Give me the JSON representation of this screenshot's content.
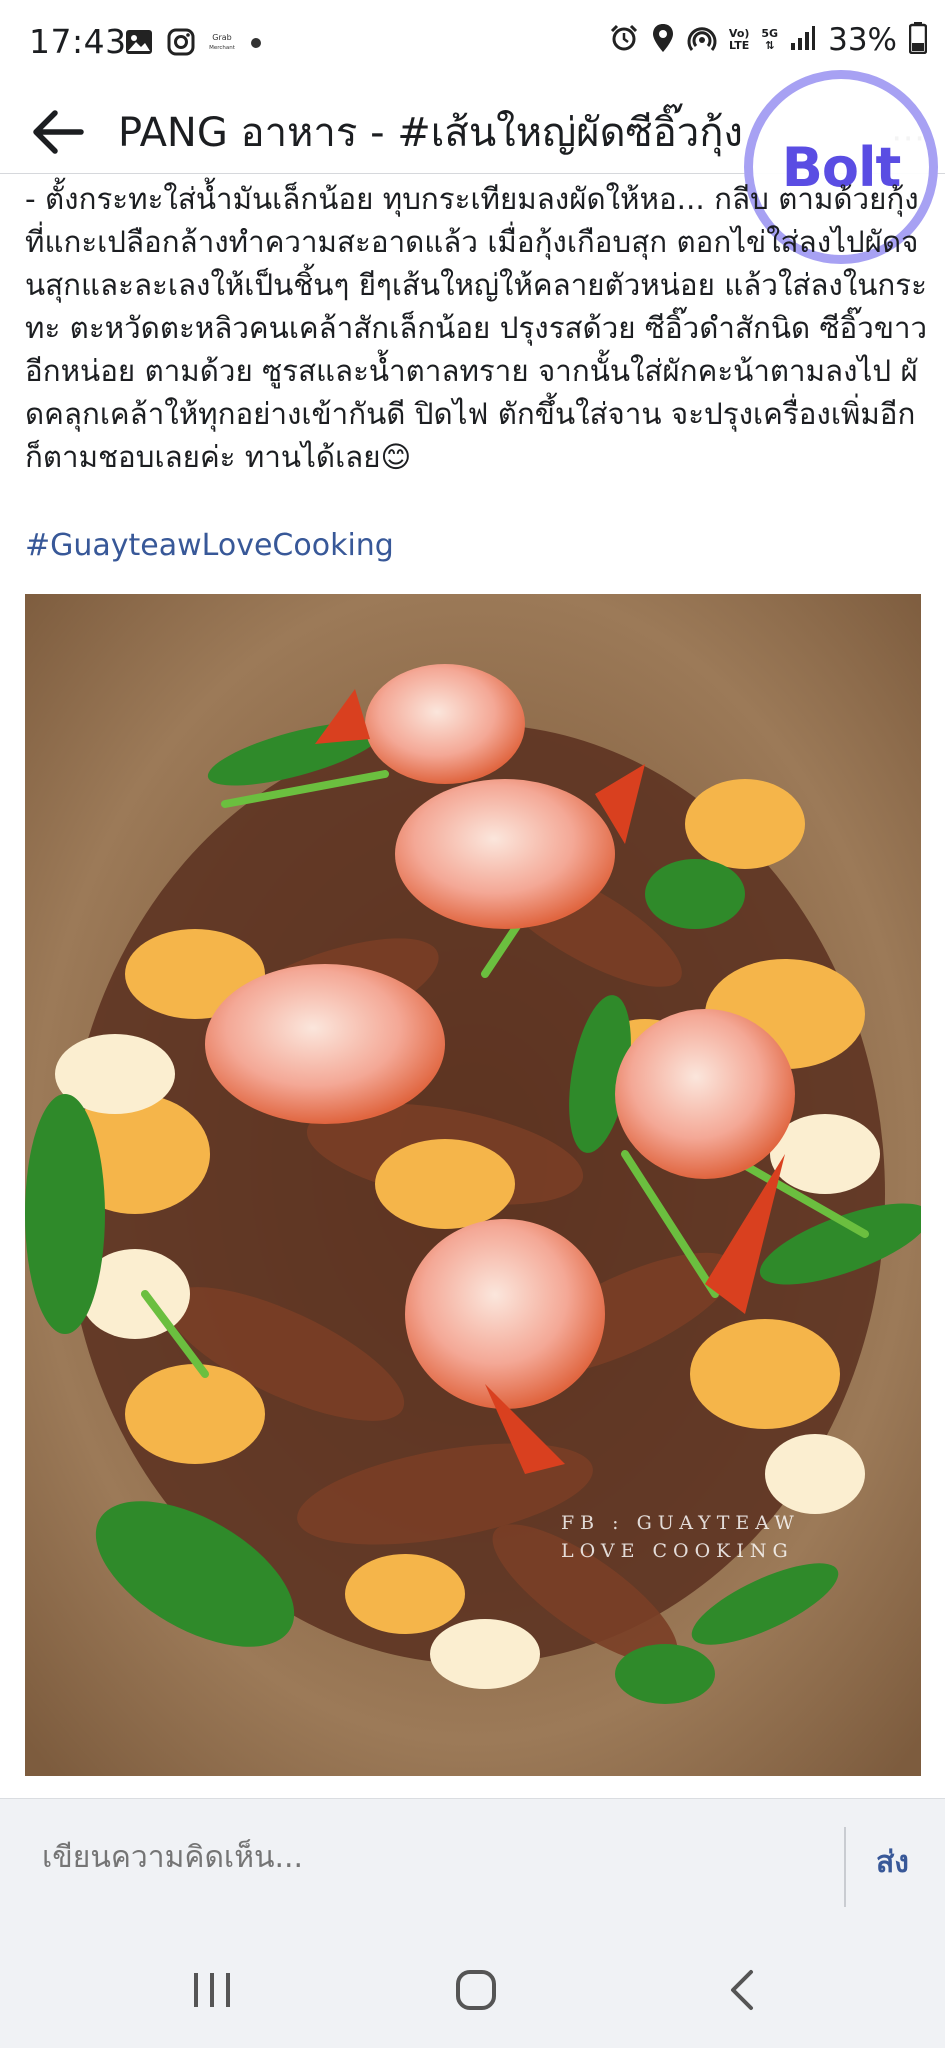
{
  "status_bar": {
    "time": "17:43",
    "left_icons": [
      "gallery-icon",
      "instagram-icon",
      "grab-merchant-icon",
      "notification-dot-icon"
    ],
    "right_icons": [
      "alarm-icon",
      "location-icon",
      "hotspot-icon",
      "volte-icon",
      "5g-icon",
      "signal-icon",
      "battery-icon"
    ],
    "volte_label_top": "Vo)",
    "volte_label_bottom": "LTE",
    "net_label": "5G",
    "battery": "33%"
  },
  "header": {
    "title": "PANG อาหาร - #เส้นใหญ่ผัดซีอิ๊วกุ้ง"
  },
  "bolt_badge": {
    "text": "Bolt",
    "ring_color": "#a7a1f3",
    "text_color": "#5a4de3"
  },
  "post": {
    "text": "- ตั้งกระทะใส่น้ำมันเล็กน้อย ทุบกระเทียมลงผัดให้หอ... กลีบ ตามด้วยกุ้งที่แกะเปลือกล้างทำความสะอาดแล้ว เมื่อกุ้งเกือบสุก ตอกไข่ใส่ลงไปผัดจนสุกและละเลงให้เป็นชิ้นๆ ยีๆเส้นใหญ่ให้คลายตัวหน่อย แล้วใส่ลงในกระทะ ตะหวัดตะหลิวคนเคล้าสักเล็กน้อย ปรุงรสด้วย ซีอิ๊วดำสักนิด ซีอิ๊วขาวอีกหน่อย ตามด้วย ซูรสและน้ำตาลทราย จากนั้นใส่ผักคะน้าตามลงไป ผัดคลุกเคล้าให้ทุกอย่างเข้ากันดี ปิดไฟ ตักขึ้นใส่จาน จะปรุงเครื่องเพิ่มอีกก็ตามชอบเลยค่ะ ทานได้เลย😊",
    "hashtag": "#GuayteawLoveCooking",
    "photo_watermark": "FB : GUAYTEAW\nLOVE COOKING"
  },
  "comment_bar": {
    "placeholder": "เขียนความคิดเห็น...",
    "send_label": "ส่ง"
  },
  "nav_bar": {
    "buttons": [
      "recent-apps-icon",
      "home-icon",
      "back-nav-icon"
    ]
  },
  "colors": {
    "link": "#385898",
    "bar_background": "#f0f2f5"
  }
}
